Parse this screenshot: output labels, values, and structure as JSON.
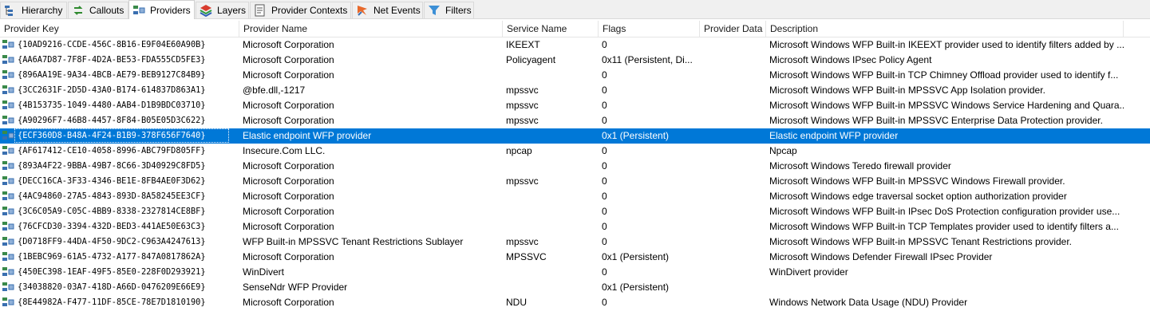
{
  "tabs": [
    {
      "label": "Hierarchy",
      "icon": "hierarchy-icon",
      "active": false
    },
    {
      "label": "Callouts",
      "icon": "callouts-icon",
      "active": false
    },
    {
      "label": "Providers",
      "icon": "providers-icon",
      "active": true
    },
    {
      "label": "Layers",
      "icon": "layers-icon",
      "active": false
    },
    {
      "label": "Provider Contexts",
      "icon": "provider-contexts-icon",
      "active": false
    },
    {
      "label": "Net Events",
      "icon": "net-events-icon",
      "active": false
    },
    {
      "label": "Filters",
      "icon": "filters-icon",
      "active": false
    }
  ],
  "columns": [
    "Provider Key",
    "Provider Name",
    "Service Name",
    "Flags",
    "Provider Data",
    "Description"
  ],
  "selected_row": 6,
  "rows": [
    {
      "key": "{10AD9216-CCDE-456C-8B16-E9F04E60A90B}",
      "name": "Microsoft Corporation",
      "service": "IKEEXT",
      "flags": "0",
      "data": "",
      "description": "Microsoft Windows WFP Built-in IKEEXT provider used to identify filters added by ..."
    },
    {
      "key": "{AA6A7D87-7F8F-4D2A-BE53-FDA555CD5FE3}",
      "name": "Microsoft Corporation",
      "service": "Policyagent",
      "flags": "0x11 (Persistent, Di...",
      "data": "",
      "description": "Microsoft Windows IPsec Policy Agent"
    },
    {
      "key": "{896AA19E-9A34-4BCB-AE79-BEB9127C84B9}",
      "name": "Microsoft Corporation",
      "service": "",
      "flags": "0",
      "data": "",
      "description": "Microsoft Windows WFP Built-in TCP Chimney Offload provider used to identify f..."
    },
    {
      "key": "{3CC2631F-2D5D-43A0-B174-614837D863A1}",
      "name": "@bfe.dll,-1217",
      "service": "mpssvc",
      "flags": "0",
      "data": "",
      "description": "Microsoft Windows WFP Built-in MPSSVC App Isolation provider."
    },
    {
      "key": "{4B153735-1049-4480-AAB4-D1B9BDC03710}",
      "name": "Microsoft Corporation",
      "service": "mpssvc",
      "flags": "0",
      "data": "",
      "description": "Microsoft Windows WFP Built-in MPSSVC Windows Service Hardening and Quara..."
    },
    {
      "key": "{A90296F7-46B8-4457-8F84-B05E05D3C622}",
      "name": "Microsoft Corporation",
      "service": "mpssvc",
      "flags": "0",
      "data": "",
      "description": "Microsoft Windows WFP Built-in MPSSVC Enterprise Data Protection provider."
    },
    {
      "key": "{ECF360D8-B48A-4F24-B1B9-378F656F7640}",
      "name": "Elastic endpoint WFP provider",
      "service": "",
      "flags": "0x1 (Persistent)",
      "data": "",
      "description": "Elastic endpoint WFP provider"
    },
    {
      "key": "{AF617412-CE10-4058-8996-ABC79FD805FF}",
      "name": "Insecure.Com LLC.",
      "service": "npcap",
      "flags": "0",
      "data": "",
      "description": "Npcap"
    },
    {
      "key": "{893A4F22-9BBA-49B7-8C66-3D40929C8FD5}",
      "name": "Microsoft Corporation",
      "service": "",
      "flags": "0",
      "data": "",
      "description": "Microsoft Windows Teredo firewall provider"
    },
    {
      "key": "{DECC16CA-3F33-4346-BE1E-8FB4AE0F3D62}",
      "name": "Microsoft Corporation",
      "service": "mpssvc",
      "flags": "0",
      "data": "",
      "description": "Microsoft Windows WFP Built-in MPSSVC Windows Firewall provider."
    },
    {
      "key": "{4AC94860-27A5-4843-893D-8A58245EE3CF}",
      "name": "Microsoft Corporation",
      "service": "",
      "flags": "0",
      "data": "",
      "description": "Microsoft Windows edge traversal socket option authorization provider"
    },
    {
      "key": "{3C6C05A9-C05C-4BB9-8338-2327814CE8BF}",
      "name": "Microsoft Corporation",
      "service": "",
      "flags": "0",
      "data": "",
      "description": "Microsoft Windows WFP Built-in IPsec DoS Protection configuration provider use..."
    },
    {
      "key": "{76CFCD30-3394-432D-BED3-441AE50E63C3}",
      "name": "Microsoft Corporation",
      "service": "",
      "flags": "0",
      "data": "",
      "description": "Microsoft Windows WFP Built-in TCP Templates provider used to identify filters a..."
    },
    {
      "key": "{D0718FF9-44DA-4F50-9DC2-C963A4247613}",
      "name": "WFP Built-in MPSSVC Tenant Restrictions Sublayer",
      "service": "mpssvc",
      "flags": "0",
      "data": "",
      "description": "Microsoft Windows WFP Built-in MPSSVC Tenant Restrictions provider."
    },
    {
      "key": "{1BEBC969-61A5-4732-A177-847A0817862A}",
      "name": "Microsoft Corporation",
      "service": "MPSSVC",
      "flags": "0x1 (Persistent)",
      "data": "",
      "description": "Microsoft Windows Defender Firewall IPsec Provider"
    },
    {
      "key": "{450EC398-1EAF-49F5-85E0-228F0D293921}",
      "name": "WinDivert",
      "service": "",
      "flags": "0",
      "data": "",
      "description": "WinDivert provider"
    },
    {
      "key": "{34038820-03A7-418D-A66D-0476209E66E9}",
      "name": "SenseNdr WFP Provider",
      "service": "",
      "flags": "0x1 (Persistent)",
      "data": "",
      "description": ""
    },
    {
      "key": "{8E44982A-F477-11DF-85CE-78E7D1810190}",
      "name": "Microsoft Corporation",
      "service": "NDU",
      "flags": "0",
      "data": "",
      "description": "Windows Network Data Usage (NDU) Provider"
    }
  ],
  "colors": {
    "selection": "#0078d7",
    "tab_bg": "#f0f0f0",
    "grid_line": "#e5e5e5"
  }
}
